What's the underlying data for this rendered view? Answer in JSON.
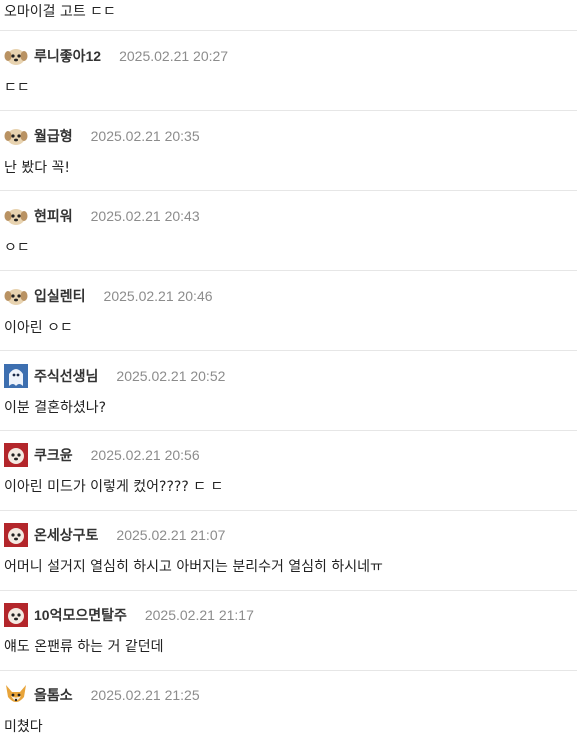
{
  "top_text": "오마이걸 고트 ㄷㄷ",
  "comments": [
    {
      "nickname": "루니좋아12",
      "time": "2025.02.21 20:27",
      "text": "ㄷㄷ",
      "avatar_icon": "puppy-avatar-icon-light"
    },
    {
      "nickname": "월급형",
      "time": "2025.02.21 20:35",
      "text": "난 봤다 꼭!",
      "avatar_icon": "puppy-avatar-icon-light"
    },
    {
      "nickname": "현피워",
      "time": "2025.02.21 20:43",
      "text": "ㅇㄷ",
      "avatar_icon": "puppy-avatar-icon-light"
    },
    {
      "nickname": "입실렌티",
      "time": "2025.02.21 20:46",
      "text": "이아린 ㅇㄷ",
      "avatar_icon": "puppy-avatar-icon-light"
    },
    {
      "nickname": "주식선생님",
      "time": "2025.02.21 20:52",
      "text": "이분 결혼하셨나?",
      "avatar_icon": "ghost-avatar-icon-blue"
    },
    {
      "nickname": "쿠크윤",
      "time": "2025.02.21 20:56",
      "text": "이아린 미드가 이렇게 컸어???? ㄷ ㄷ",
      "avatar_icon": "puppy-avatar-icon-red"
    },
    {
      "nickname": "온세상구토",
      "time": "2025.02.21 21:07",
      "text": "어머니 설거지 열심히 하시고 아버지는 분리수거 열심히 하시네ㅠ",
      "avatar_icon": "puppy-avatar-icon-red"
    },
    {
      "nickname": "10억모으면탈주",
      "time": "2025.02.21 21:17",
      "text": "얘도 온팬류 하는 거 같던데",
      "avatar_icon": "puppy-avatar-icon-red"
    },
    {
      "nickname": "올톰소",
      "time": "2025.02.21 21:25",
      "text": "미쳤다",
      "avatar_icon": "fox-avatar-icon"
    }
  ],
  "colors": {
    "nickname": "#333333",
    "time": "#8c8c8c",
    "text": "#222222",
    "divider": "#e6e6e6",
    "puppy_light": "#e8d3b0",
    "puppy_red": "#b3262b",
    "ghost_blue": "#3d6fb0",
    "fox": "#e8a43a"
  }
}
